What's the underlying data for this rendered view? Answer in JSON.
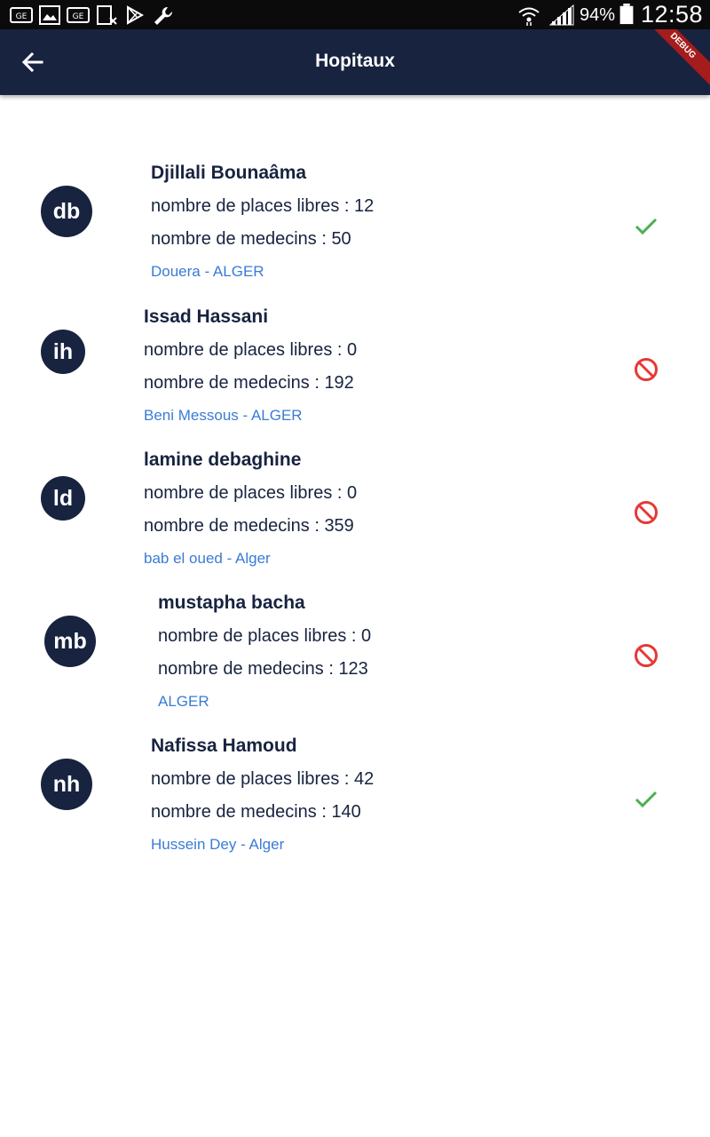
{
  "status_bar": {
    "left_icons": [
      "gmail-like-icon",
      "image-icon",
      "gmail-like-icon",
      "sim-icon",
      "play-store-icon",
      "wrench-icon"
    ],
    "battery_percent": "94%",
    "time": "12:58"
  },
  "app_bar": {
    "title": "Hopitaux",
    "back_icon": "arrow-left-icon",
    "debug_banner": "DEBUG"
  },
  "colors": {
    "primary": "#17233f",
    "link": "#3a7bd5",
    "available": "#4caf50",
    "unavailable": "#e53935"
  },
  "hospitals": [
    {
      "initials": "db",
      "name": "Djillali Bounaâma",
      "places": "nombre de places libres : 12",
      "doctors": "nombre de medecins  : 50",
      "location": " Douera - ALGER",
      "status_icon": "check-icon"
    },
    {
      "initials": "ih",
      "name": "Issad Hassani",
      "places": "nombre de places libres : 0",
      "doctors": "nombre de medecins  : 192",
      "location": " Beni Messous - ALGER",
      "status_icon": "block-icon"
    },
    {
      "initials": "ld",
      "name": "lamine debaghine",
      "places": "nombre de places libres : 0",
      "doctors": "nombre de medecins  : 359",
      "location": "bab el oued - Alger",
      "status_icon": "block-icon"
    },
    {
      "initials": "mb",
      "name": "mustapha bacha",
      "places": "nombre de places libres : 0",
      "doctors": "nombre de medecins  : 123",
      "location": "ALGER",
      "status_icon": "block-icon"
    },
    {
      "initials": "nh",
      "name": "Nafissa Hamoud",
      "places": "nombre de places libres : 42",
      "doctors": "nombre de medecins  : 140",
      "location": "Hussein Dey - Alger",
      "status_icon": "check-icon"
    }
  ]
}
